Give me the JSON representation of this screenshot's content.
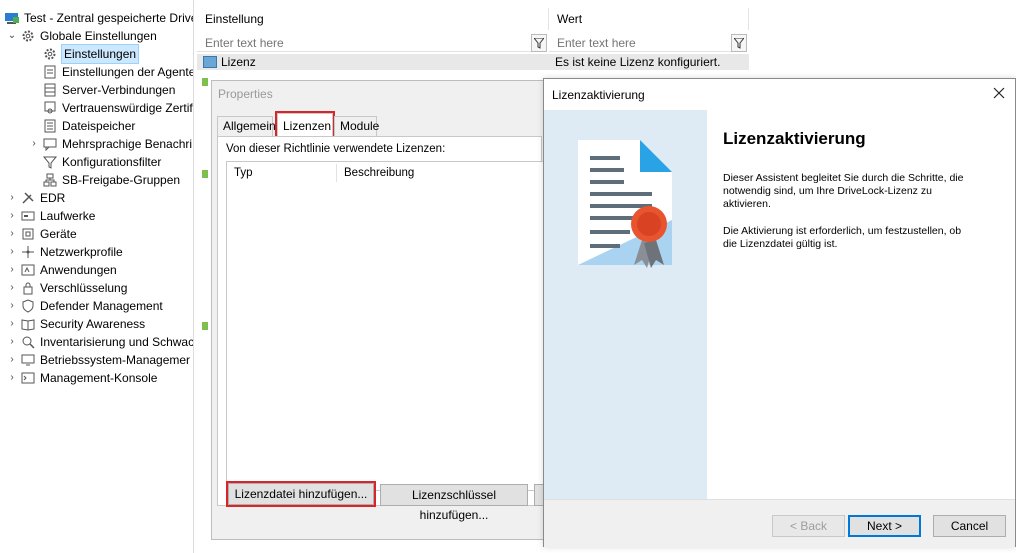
{
  "tree": {
    "root": "Test - Zentral gespeicherte Drive",
    "items": [
      {
        "label": "Globale Einstellungen",
        "icon": "gear-icon"
      },
      {
        "label": "Einstellungen",
        "icon": "gear-icon"
      },
      {
        "label": "Einstellungen der Agente",
        "icon": "document-icon"
      },
      {
        "label": "Server-Verbindungen",
        "icon": "server-icon"
      },
      {
        "label": "Vertrauenswürdige Zertif",
        "icon": "certificate-icon"
      },
      {
        "label": "Dateispeicher",
        "icon": "storage-icon"
      },
      {
        "label": "Mehrsprachige Benachri",
        "icon": "notification-icon"
      },
      {
        "label": "Konfigurationsfilter",
        "icon": "filter-icon"
      },
      {
        "label": "SB-Freigabe-Gruppen",
        "icon": "share-icon"
      },
      {
        "label": "EDR",
        "icon": "tools-icon"
      },
      {
        "label": "Laufwerke",
        "icon": "drive-icon"
      },
      {
        "label": "Geräte",
        "icon": "device-icon"
      },
      {
        "label": "Netzwerkprofile",
        "icon": "network-icon"
      },
      {
        "label": "Anwendungen",
        "icon": "application-icon"
      },
      {
        "label": "Verschlüsselung",
        "icon": "lock-icon"
      },
      {
        "label": "Defender Management",
        "icon": "shield-icon"
      },
      {
        "label": "Security Awareness",
        "icon": "book-icon"
      },
      {
        "label": "Inventarisierung und Schwac",
        "icon": "inventory-icon"
      },
      {
        "label": "Betriebssystem-Managemer",
        "icon": "monitor-icon"
      },
      {
        "label": "Management-Konsole",
        "icon": "console-icon"
      }
    ]
  },
  "grid": {
    "col_setting": "Einstellung",
    "col_value": "Wert",
    "filter_placeholder": "Enter text here",
    "row_setting": "Lizenz",
    "row_value": "Es ist keine Lizenz konfiguriert."
  },
  "properties": {
    "title": "Properties",
    "tabs": [
      "Allgemein",
      "Lizenzen",
      "Module"
    ],
    "label": "Von dieser Richtlinie verwendete Lizenzen:",
    "col_type": "Typ",
    "col_desc": "Beschreibung",
    "btn_add_file": "Lizenzdatei hinzufügen...",
    "btn_add_key": "Lizenzschlüssel hinzufügen..."
  },
  "wizard": {
    "title": "Lizenzaktivierung",
    "heading": "Lizenzaktivierung",
    "para1": "Dieser Assistent begleitet Sie durch die Schritte, die notwendig sind, um Ihre DriveLock-Lizenz zu aktivieren.",
    "para2": "Die Aktivierung ist erforderlich, um festzustellen, ob die Lizenzdatei gültig ist.",
    "btn_back": "< Back",
    "btn_next": "Next >",
    "btn_cancel": "Cancel"
  },
  "colors": {
    "selection": "#cce8ff",
    "highlight": "#d9242a",
    "wizard_side": "#deebf4",
    "seal": "#e8542f"
  }
}
